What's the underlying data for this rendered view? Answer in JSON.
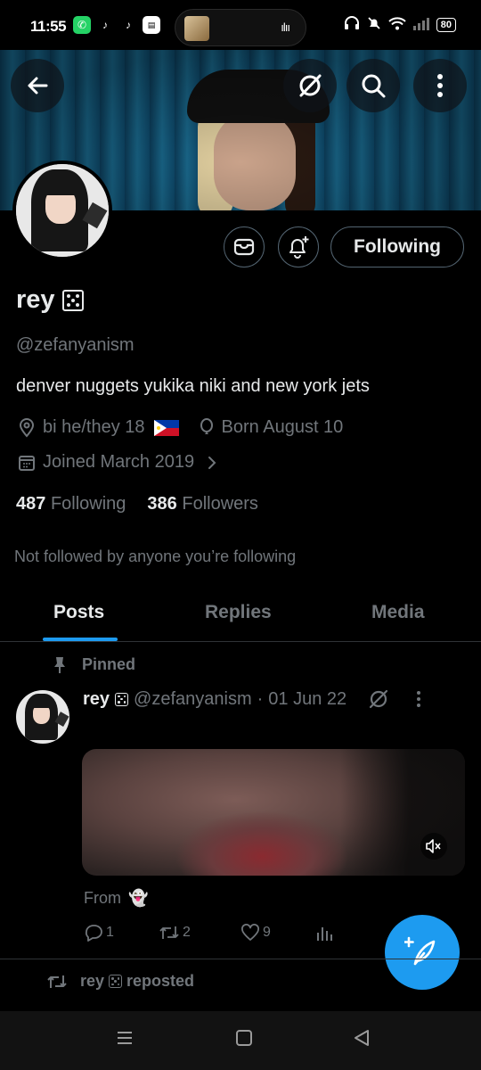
{
  "status_bar": {
    "time": "11:55",
    "battery": "80",
    "apps": [
      "whatsapp-icon",
      "tiktok-icon",
      "tiktok-icon",
      "news-icon"
    ],
    "island_wave": "ılıı"
  },
  "profile": {
    "display_name": "rey",
    "handle": "@zefanyanism",
    "bio": "denver nuggets yukika niki and new york jets",
    "location": "bi he/they 18",
    "birthday": "Born August 10",
    "joined": "Joined March 2019",
    "following_count": "487",
    "following_label": "Following",
    "followers_count": "386",
    "followers_label": "Followers",
    "not_followed_text": "Not followed by anyone you’re following",
    "follow_button_label": "Following"
  },
  "tabs": [
    {
      "label": "Posts",
      "active": true
    },
    {
      "label": "Replies",
      "active": false
    },
    {
      "label": "Media",
      "active": false
    }
  ],
  "pinned_post": {
    "pinned_label": "Pinned",
    "author_name": "rey",
    "author_handle": "@zefanyanism",
    "separator": "·",
    "date": "01 Jun 22",
    "from_text": "From",
    "from_emoji": "👻",
    "replies": "1",
    "reposts": "2",
    "likes": "9"
  },
  "next_post": {
    "repost_text": "rey",
    "repost_suffix": "reposted"
  },
  "colors": {
    "accent": "#1d9bf0",
    "muted": "#71767b",
    "text": "#e7e9ea",
    "border": "#2f3336"
  }
}
